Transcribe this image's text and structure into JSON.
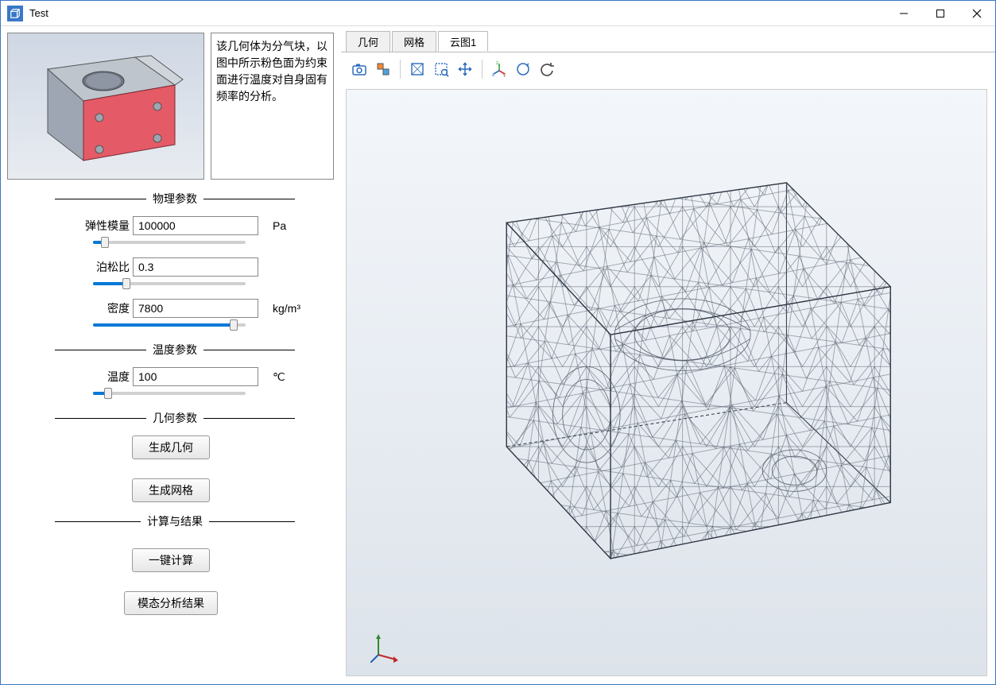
{
  "window": {
    "title": "Test"
  },
  "description": "该几何体为分气块，以图中所示粉色面为约束面进行温度对自身固有频率的分析。",
  "sections": {
    "physical": {
      "title": "物理参数"
    },
    "temperature": {
      "title": "温度参数"
    },
    "geometry": {
      "title": "几何参数"
    },
    "compute": {
      "title": "计算与结果"
    }
  },
  "params": {
    "elastic_modulus": {
      "label": "弹性模量",
      "value": "100000",
      "unit": "Pa",
      "slider_pct": 8
    },
    "poisson": {
      "label": "泊松比",
      "value": "0.3",
      "unit": "",
      "slider_pct": 22
    },
    "density": {
      "label": "密度",
      "value": "7800",
      "unit": "kg/m³",
      "slider_pct": 92
    },
    "temperature": {
      "label": "温度",
      "value": "100",
      "unit": "℃",
      "slider_pct": 10
    }
  },
  "buttons": {
    "gen_geometry": "生成几何",
    "gen_mesh": "生成网格",
    "one_click_compute": "一键计算",
    "modal_result": "模态分析结果"
  },
  "tabs": {
    "geometry": "几何",
    "mesh": "网格",
    "cloud1": "云图1"
  }
}
